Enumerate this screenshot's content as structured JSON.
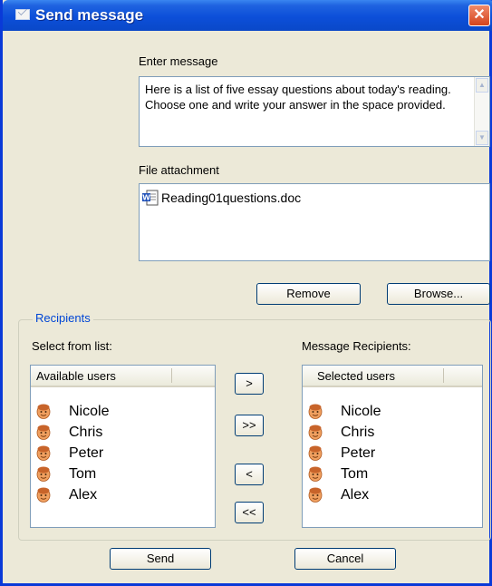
{
  "window": {
    "title": "Send message",
    "close_glyph": "✕"
  },
  "message": {
    "label": "Enter message",
    "text": "Here is a list of five essay questions about today's reading. Choose one and write your answer in the space provided."
  },
  "attachment": {
    "label": "File attachment",
    "file_name": "Reading01questions.doc",
    "file_icon": "word-doc-icon"
  },
  "buttons": {
    "remove": "Remove",
    "browse": "Browse...",
    "send": "Send",
    "cancel": "Cancel",
    "add": ">",
    "add_all": ">>",
    "remove_one": "<",
    "remove_all": "<<"
  },
  "recipients": {
    "group_label": "Recipients",
    "select_label": "Select from list:",
    "message_label": "Message Recipients:",
    "available_header": "Available users",
    "selected_header": "Selected users",
    "available": [
      "Nicole",
      "Chris",
      "Peter",
      "Tom",
      "Alex"
    ],
    "selected": [
      "Nicole",
      "Chris",
      "Peter",
      "Tom",
      "Alex"
    ],
    "user_icon": "user-face-icon"
  },
  "colors": {
    "title_bar": "#0c4fd9",
    "close_button": "#d4441c",
    "group_label": "#0046d5"
  }
}
